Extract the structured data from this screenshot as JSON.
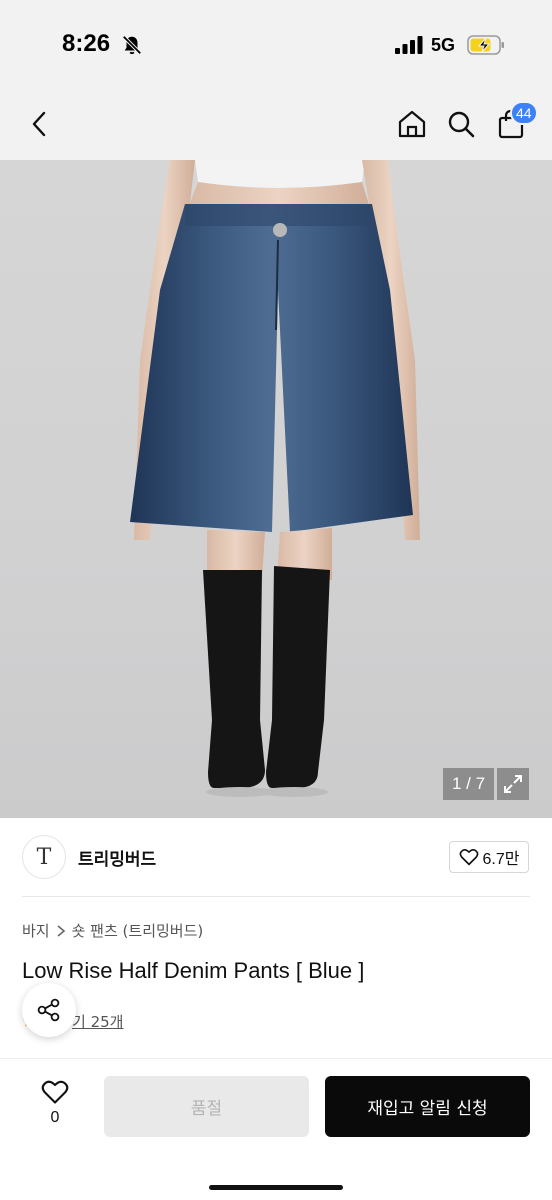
{
  "status_bar": {
    "time": "8:26",
    "network": "5G",
    "icons": [
      "bell-slash-icon",
      "signal-icon",
      "battery-charging-icon"
    ]
  },
  "nav": {
    "icons": [
      "chevron-left-icon",
      "home-icon",
      "search-icon",
      "shopping-bag-icon"
    ],
    "cart_count": "44"
  },
  "gallery": {
    "page_indicator": "1 / 7",
    "current_page": 1,
    "total_pages": 7,
    "icons": [
      "expand-icon"
    ]
  },
  "brand": {
    "logo_text": "T",
    "name": "트리밍버드",
    "like_count": "6.7만"
  },
  "product": {
    "breadcrumb": [
      "바지",
      "숏 팬츠 (트리밍버드)"
    ],
    "title": "Low Rise Half Denim Pants [ Blue ]",
    "review_text": "기 25개",
    "icons": [
      "star-icon",
      "share-icon"
    ]
  },
  "bottom_bar": {
    "wish_count": "0",
    "soldout_label": "품절",
    "restock_label": "재입고 알림 신청",
    "icons": [
      "heart-icon"
    ]
  }
}
